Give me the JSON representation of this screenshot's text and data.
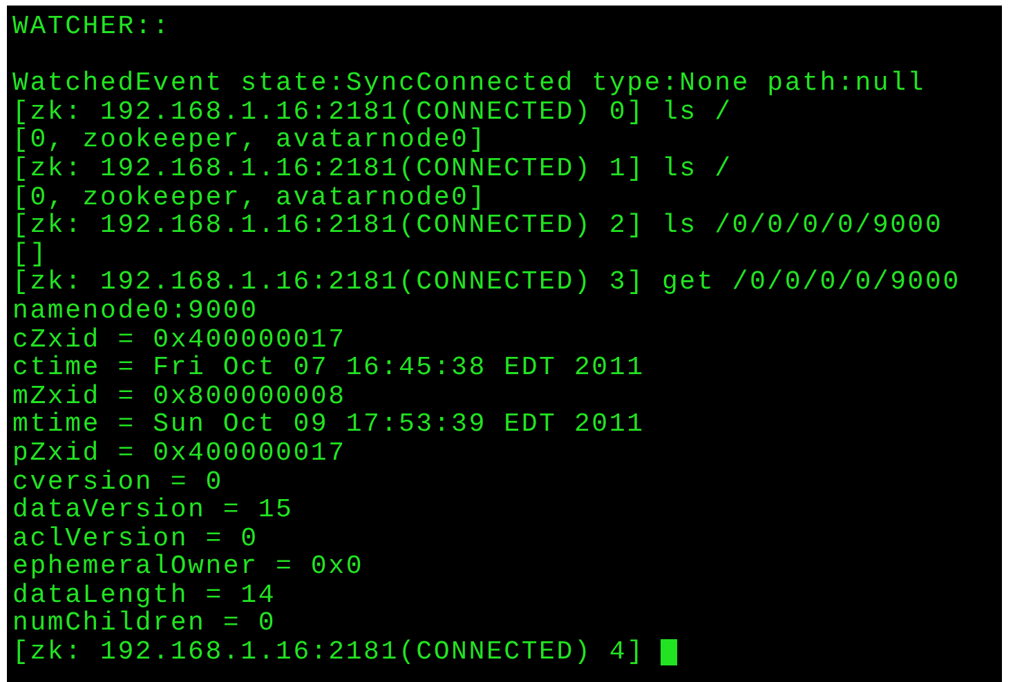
{
  "terminal": {
    "header": "WATCHER::",
    "lines": [
      "WatchedEvent state:SyncConnected type:None path:null",
      "[zk: 192.168.1.16:2181(CONNECTED) 0] ls /",
      "[0, zookeeper, avatarnode0]",
      "[zk: 192.168.1.16:2181(CONNECTED) 1] ls /",
      "[0, zookeeper, avatarnode0]",
      "[zk: 192.168.1.16:2181(CONNECTED) 2] ls /0/0/0/0/9000",
      "[]",
      "[zk: 192.168.1.16:2181(CONNECTED) 3] get /0/0/0/0/9000",
      "namenode0:9000",
      "cZxid = 0x400000017",
      "ctime = Fri Oct 07 16:45:38 EDT 2011",
      "mZxid = 0x800000008",
      "mtime = Sun Oct 09 17:53:39 EDT 2011",
      "pZxid = 0x400000017",
      "cversion = 0",
      "dataVersion = 15",
      "aclVersion = 0",
      "ephemeralOwner = 0x0",
      "dataLength = 14",
      "numChildren = 0"
    ],
    "prompt": "[zk: 192.168.1.16:2181(CONNECTED) 4]",
    "cursor_visible": true
  }
}
